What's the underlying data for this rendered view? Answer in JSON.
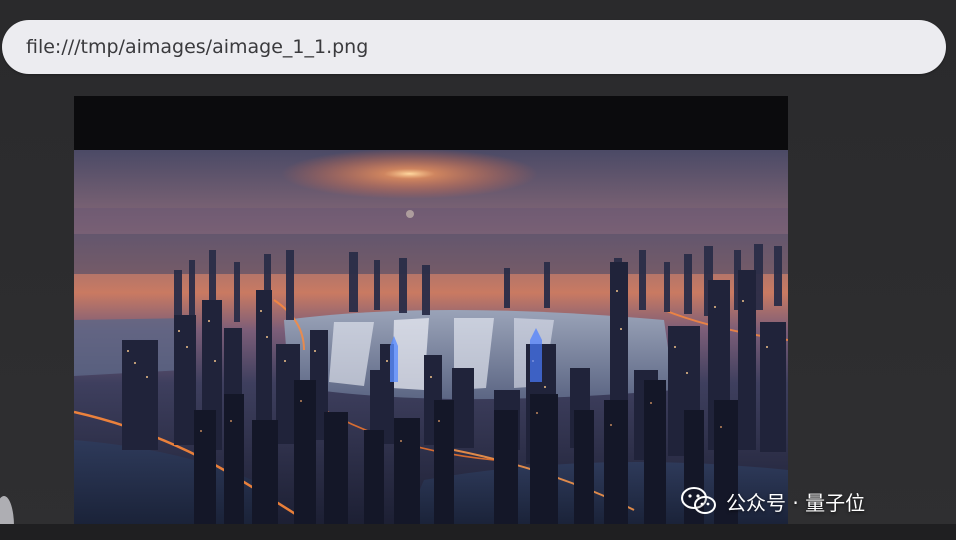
{
  "address_bar": {
    "url": "file:///tmp/aimages/aimage_1_1.png"
  },
  "image": {
    "subject_icon": "city-skyline-image"
  },
  "watermark": {
    "icon": "wechat-icon",
    "text": "公众号 · 量子位"
  }
}
